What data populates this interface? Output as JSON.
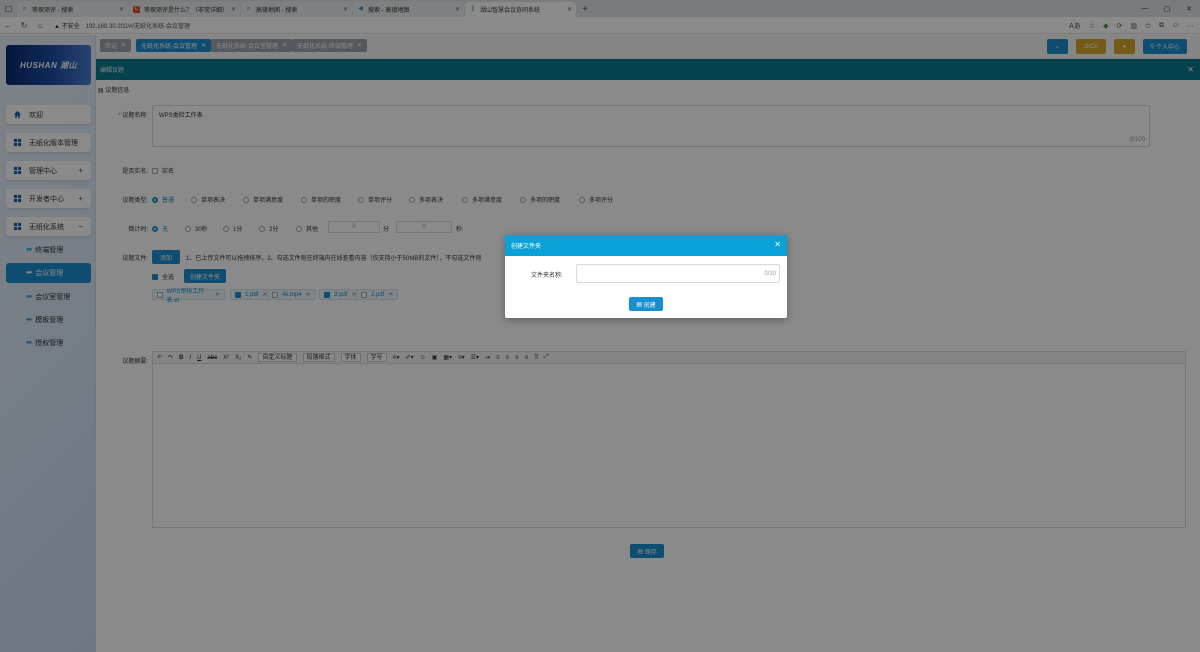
{
  "browser": {
    "tabs": [
      {
        "title": "等保测评 - 搜索",
        "icon": "search-icon"
      },
      {
        "title": "等保测评是什么？（非常详细）零",
        "icon": "csdn-icon"
      },
      {
        "title": "高德地图 - 搜索",
        "icon": "search-icon"
      },
      {
        "title": "搜索 - 高德地图",
        "icon": "map-pin-icon"
      },
      {
        "title": "湖山智慧会议协同系统",
        "icon": "app-icon"
      }
    ],
    "security": "不安全",
    "url": "192.168.30.202/#/无纸化系统-会议管理",
    "translate_label": "Aあ"
  },
  "sidebar": {
    "logo": "HUSHAN 湖山",
    "items": [
      {
        "label": "欢迎",
        "icon": "home-icon",
        "toggle": ""
      },
      {
        "label": "无纸化版本管理",
        "icon": "grid-icon",
        "toggle": ""
      },
      {
        "label": "管理中心",
        "icon": "grid-icon",
        "toggle": "+"
      },
      {
        "label": "开发者中心",
        "icon": "grid-icon",
        "toggle": "+"
      },
      {
        "label": "无纸化系统",
        "icon": "grid-icon",
        "toggle": "−"
      }
    ],
    "subitems": [
      {
        "label": "终端管理"
      },
      {
        "label": "会议管理"
      },
      {
        "label": "会议室管理"
      },
      {
        "label": "模板管理"
      },
      {
        "label": "授权管理"
      }
    ]
  },
  "page_tabs": [
    {
      "label": "欢迎"
    },
    {
      "label": "无纸化系统-会议管理"
    },
    {
      "label": "无纸化系统-会议室管理"
    },
    {
      "label": "无纸化系统-终端管理"
    }
  ],
  "top_buttons": {
    "lang": "zhCn",
    "user": "个人中心"
  },
  "editbar": {
    "title": "编辑议题"
  },
  "form": {
    "section": "议题信息",
    "name_label": "议题名称:",
    "name_value": "WPS类检工作表",
    "name_count": "8/100",
    "anon_label": "是否实名:",
    "anon_option": "实名",
    "type_label": "议题类型:",
    "types": [
      "普通",
      "单项表决",
      "单项满意度",
      "单项的职度",
      "单项评分",
      "多项表决",
      "多项满意度",
      "多项的职度",
      "多项评分"
    ],
    "timer_label": "倒计时:",
    "timer_options": [
      "无",
      "30秒",
      "1分",
      "2分",
      "其他"
    ],
    "timer_min": "0",
    "timer_min_unit": "分",
    "timer_sec": "0",
    "timer_sec_unit": "秒",
    "file_label": "议题文件:",
    "add_btn": "添加",
    "file_hint": "1、已上传文件可以拖拽排序。2、勾选文件则在终端内在线查看内容（仅支持小于50MB的文件），不勾选文件则",
    "select_all": "全选",
    "create_folder_btn": "创建文件夹",
    "files": [
      {
        "name": "WPS审核工作表.et",
        "checked": false
      },
      {
        "name": "1.pdf",
        "checked": true
      },
      {
        "name": "4k.mp4",
        "checked": false
      },
      {
        "name": "3.pdf",
        "checked": true
      },
      {
        "name": "2.pdf",
        "checked": false
      }
    ],
    "summary_label": "议题摘要:",
    "editor": {
      "heading_sel": "自定义标题",
      "para_sel": "段落格式",
      "font_sel": "字体",
      "size_sel": "字号"
    },
    "save_btn": "保存"
  },
  "modal": {
    "title": "创建文件夹",
    "field_label": "文件夹名称:",
    "field_value": "",
    "field_count": "0/10",
    "create_btn": "创建"
  },
  "colors": {
    "accent": "#1a8fd0",
    "modal_header": "#0aa1d6",
    "editbar": "#0c7a8f",
    "lang_btn": "#d4a72c"
  }
}
